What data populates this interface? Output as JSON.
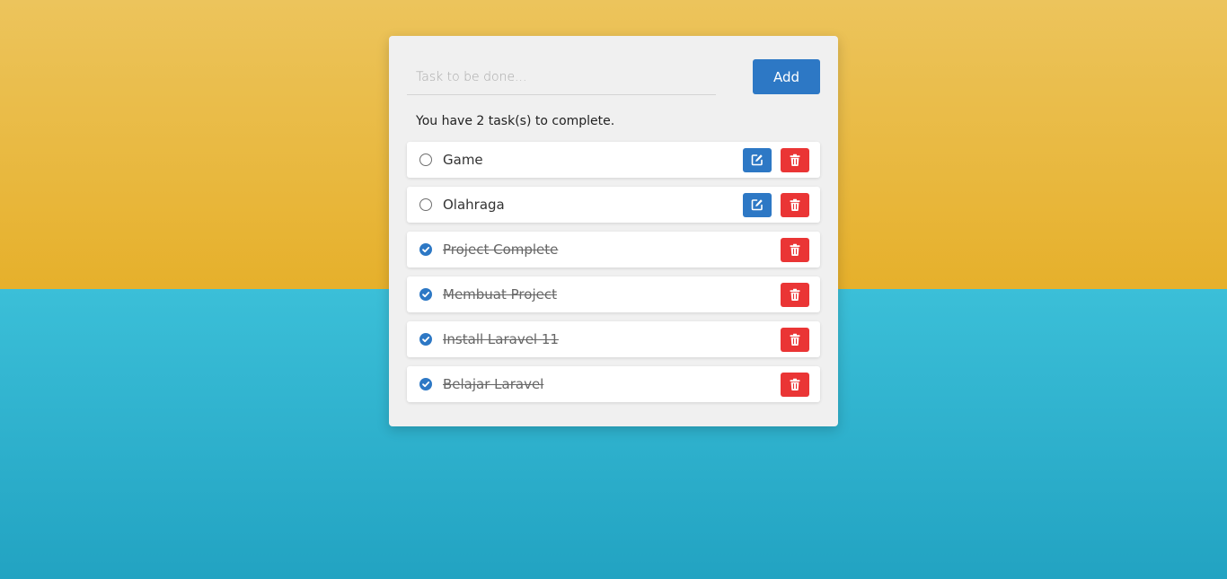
{
  "form": {
    "task_placeholder": "Task to be done...",
    "task_value": "",
    "add_label": "Add"
  },
  "summary": "You have 2 task(s) to complete.",
  "tasks": [
    {
      "label": "Game",
      "completed": false,
      "editable": true
    },
    {
      "label": "Olahraga",
      "completed": false,
      "editable": true
    },
    {
      "label": "Project Complete",
      "completed": true,
      "editable": false
    },
    {
      "label": "Membuat Project",
      "completed": true,
      "editable": false
    },
    {
      "label": "Install Laravel 11",
      "completed": true,
      "editable": false
    },
    {
      "label": "Belajar Laravel",
      "completed": true,
      "editable": false
    }
  ],
  "icons": {
    "open": "circle-icon",
    "done": "check-circle-icon",
    "edit": "edit-icon",
    "delete": "trash-icon"
  },
  "colors": {
    "primary": "#2d78c5",
    "danger": "#ea3535",
    "background_top": "#e6b02b",
    "background_bottom": "#22a3c2",
    "card": "#f0f0f0"
  }
}
